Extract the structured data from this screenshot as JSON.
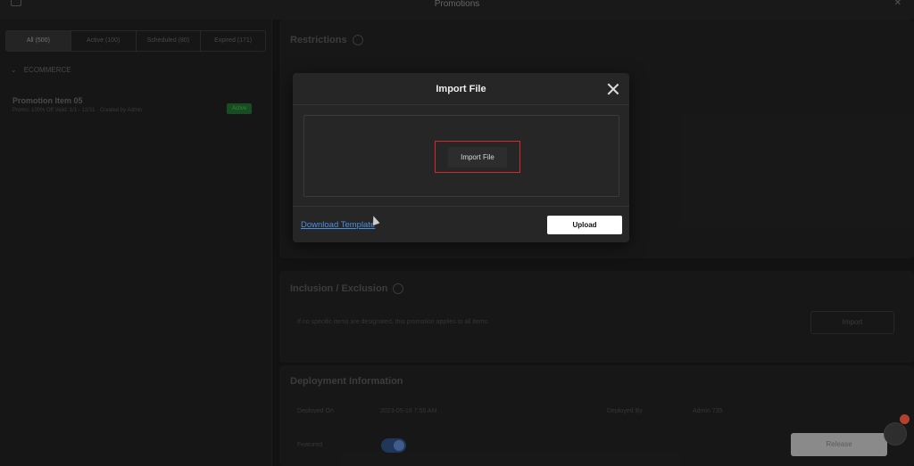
{
  "window": {
    "title": "Promotions"
  },
  "sidebar": {
    "tabs": [
      "All (500)",
      "Active (100)",
      "Scheduled (80)",
      "Expired (171)"
    ],
    "group_label": "ECOMMERCE",
    "promo": {
      "title": "Promotion Item 05",
      "sub": "Promo: 100% Off   Valid: 1/1 - 12/31 · Created by Admin",
      "badge": "Active"
    }
  },
  "main": {
    "restrictions": {
      "title": "Restrictions"
    },
    "inclusion": {
      "title": "Inclusion / Exclusion",
      "hint": "If no specific items are designated, this promotion applies to all items.",
      "button": "Import"
    },
    "deployment": {
      "title": "Deployment Information",
      "deployed_on_label": "Deployed On",
      "deployed_on_value": "2023-05-18 7:55 AM",
      "deployed_by_label": "Deployed By",
      "deployed_by_value": "Admin 735",
      "featured_label": "Featured"
    }
  },
  "modal": {
    "title": "Import File",
    "import_button": "Import File",
    "download_link": "Download Template",
    "upload_button": "Upload"
  },
  "floating": {
    "publish_button": "Release"
  },
  "colors": {
    "link": "#4a90e2",
    "highlight": "#d02a2a",
    "modal_bg": "#262626"
  }
}
